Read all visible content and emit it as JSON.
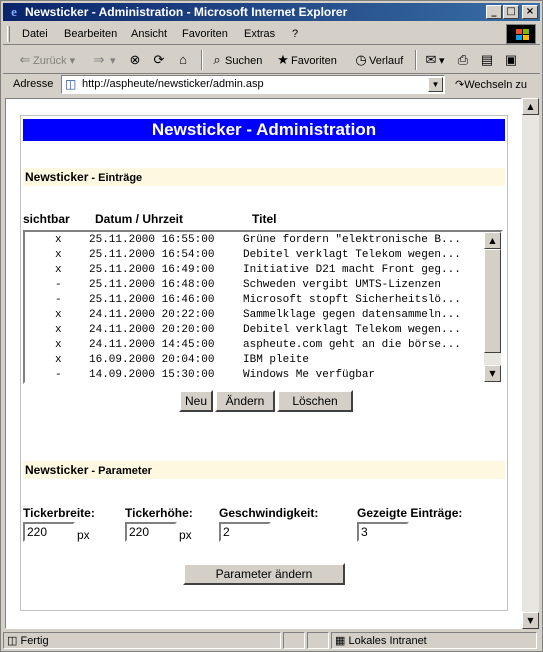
{
  "window": {
    "title": "Newsticker - Administration - Microsoft Internet Explorer",
    "buttons": {
      "minimize": "_",
      "maximize": "□",
      "close": "×"
    }
  },
  "menu": [
    "Datei",
    "Bearbeiten",
    "Ansicht",
    "Favoriten",
    "Extras",
    "?"
  ],
  "toolbar": {
    "back": "Zurück",
    "search": "Suchen",
    "favorites": "Favoriten",
    "history": "Verlauf"
  },
  "address": {
    "label": "Adresse",
    "url": "http://aspheute/newsticker/admin.asp",
    "go": "Wechseln zu"
  },
  "page": {
    "title": "Newsticker - Administration",
    "entries_section": {
      "heading": "Newsticker",
      "heading_suffix": " - Einträge",
      "columns": [
        "sichtbar",
        "Datum / Uhrzeit",
        "Titel"
      ]
    },
    "entries": [
      {
        "visible": "x",
        "datetime": "25.11.2000 16:55:00",
        "title": "Grüne fordern \"elektronische B..."
      },
      {
        "visible": "x",
        "datetime": "25.11.2000 16:54:00",
        "title": "Debitel verklagt Telekom wegen..."
      },
      {
        "visible": "x",
        "datetime": "25.11.2000 16:49:00",
        "title": "Initiative D21 macht Front geg..."
      },
      {
        "visible": "-",
        "datetime": "25.11.2000 16:48:00",
        "title": "Schweden vergibt UMTS-Lizenzen"
      },
      {
        "visible": "-",
        "datetime": "25.11.2000 16:46:00",
        "title": "Microsoft stopft Sicherheitslö..."
      },
      {
        "visible": "x",
        "datetime": "24.11.2000 20:22:00",
        "title": "Sammelklage gegen datensammeln..."
      },
      {
        "visible": "x",
        "datetime": "24.11.2000 20:20:00",
        "title": "Debitel verklagt Telekom wegen..."
      },
      {
        "visible": "x",
        "datetime": "24.11.2000 14:45:00",
        "title": "aspheute.com geht an die börse..."
      },
      {
        "visible": "x",
        "datetime": "16.09.2000 20:04:00",
        "title": "IBM pleite"
      },
      {
        "visible": "-",
        "datetime": "14.09.2000 15:30:00",
        "title": "Windows Me verfügbar"
      }
    ],
    "entry_buttons": {
      "new": "Neu",
      "edit": "Ändern",
      "delete": "Löschen"
    },
    "params_section": {
      "heading": "Newsticker",
      "heading_suffix": " - Parameter"
    },
    "params": {
      "width_label": "Tickerbreite:",
      "width_value": "220",
      "width_unit": "px",
      "height_label": "Tickerhöhe:",
      "height_value": "220",
      "height_unit": "px",
      "speed_label": "Geschwindigkeit:",
      "speed_value": "2",
      "count_label": "Gezeigte Einträge:",
      "count_value": "3",
      "submit": "Parameter ändern"
    }
  },
  "status": {
    "text": "Fertig",
    "zone": "Lokales Intranet"
  },
  "colors": {
    "title_bg": "#0000ff",
    "section_bg": "#fff8e0",
    "titlebar": "#0a246a"
  }
}
